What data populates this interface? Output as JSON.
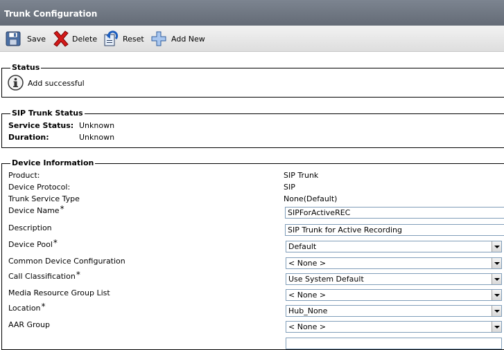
{
  "window": {
    "title": "Trunk Configuration"
  },
  "toolbar": {
    "save_label": "Save",
    "delete_label": "Delete",
    "reset_label": "Reset",
    "add_new_label": "Add New"
  },
  "status": {
    "legend": "Status",
    "message": "Add successful",
    "icon": "info-icon"
  },
  "sip_trunk_status": {
    "legend": "SIP Trunk Status",
    "service_status_label": "Service Status:",
    "service_status_value": "Unknown",
    "duration_label": "Duration:",
    "duration_value": "Unknown"
  },
  "device_info": {
    "legend": "Device Information",
    "product_label": "Product:",
    "product_value": "SIP Trunk",
    "protocol_label": "Device Protocol:",
    "protocol_value": "SIP",
    "service_type_label": "Trunk Service Type",
    "service_type_value": "None(Default)",
    "device_name_label": "Device Name",
    "device_name_value": "SIPForActiveREC",
    "description_label": "Description",
    "description_value": "SIP Trunk for Active Recording",
    "device_pool_label": "Device Pool",
    "device_pool_value": "Default",
    "common_config_label": "Common Device Configuration",
    "common_config_value": "< None >",
    "call_class_label": "Call Classification",
    "call_class_value": "Use System Default",
    "mrgl_label": "Media Resource Group List",
    "mrgl_value": "< None >",
    "location_label": "Location",
    "location_value": "Hub_None",
    "aar_group_label": "AAR Group",
    "aar_group_value": "< None >",
    "required_marker": "*"
  }
}
